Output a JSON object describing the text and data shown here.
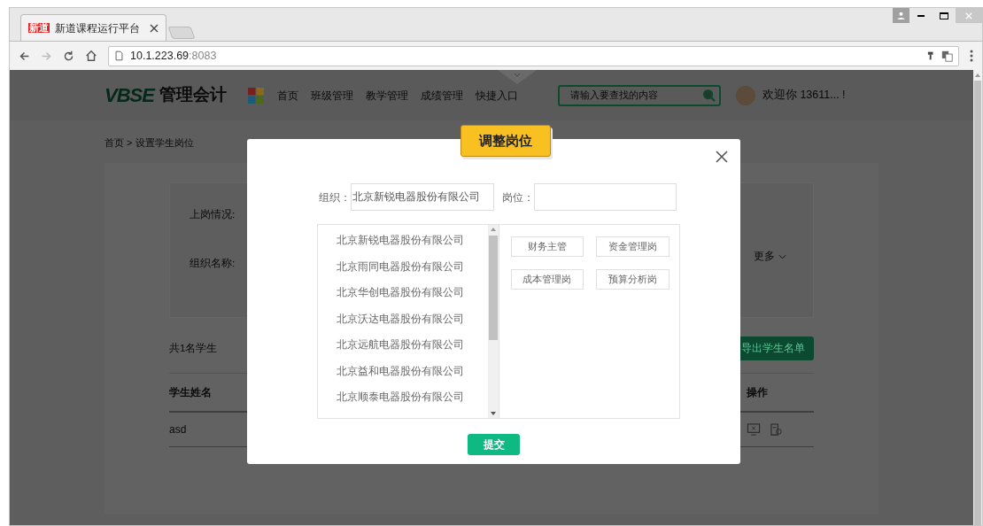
{
  "browser": {
    "tab_title": "新道课程运行平台",
    "tab_logo": "新道",
    "url_host": "10.1.223.69",
    "url_port": ":8083"
  },
  "header": {
    "logo": "VBSE",
    "brand": "管理会计",
    "nav": [
      "首页",
      "班级管理",
      "教学管理",
      "成绩管理",
      "快捷入口"
    ],
    "search": {
      "placeholder": "请输入要查找的内容"
    },
    "welcome": "欢迎你 13611... !"
  },
  "breadcrumb": "首页 > 设置学生岗位",
  "filters": {
    "labels": [
      "上岗情况:",
      "组织名称:"
    ],
    "more": "更多"
  },
  "summary": "共1名学生",
  "export_button": "导出学生名单",
  "table": {
    "columns": [
      "学生姓名",
      "操作"
    ],
    "rows": [
      {
        "name": "asd"
      }
    ]
  },
  "modal": {
    "title": "调整岗位",
    "org_label": "组织：",
    "org_value": "北京新锐电器股份有限公司",
    "position_label": "岗位：",
    "companies": [
      "北京新锐电器股份有限公司",
      "北京雨同电器股份有限公司",
      "北京华创电器股份有限公司",
      "北京沃达电器股份有限公司",
      "北京远航电器股份有限公司",
      "北京益和电器股份有限公司",
      "北京顺泰电器股份有限公司"
    ],
    "positions": [
      "财务主管",
      "资金管理岗",
      "成本管理岗",
      "预算分析岗"
    ],
    "submit": "提交"
  }
}
